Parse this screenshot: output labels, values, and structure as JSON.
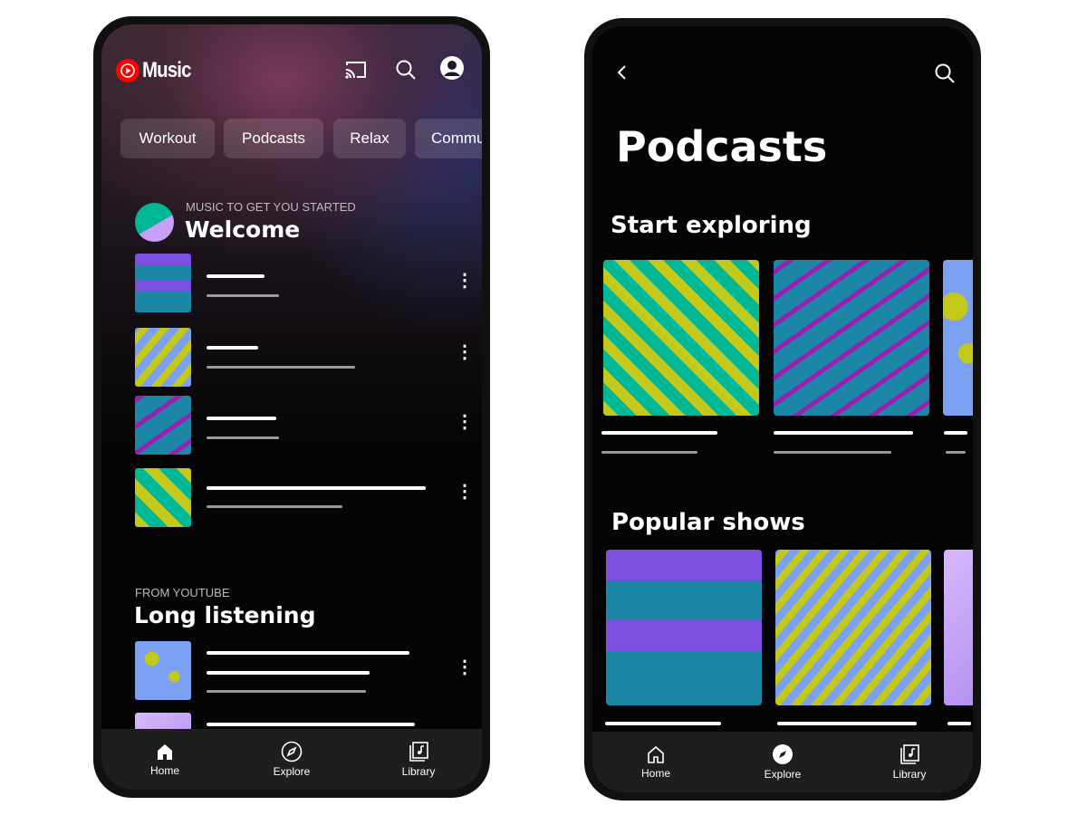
{
  "home": {
    "app_name": "Music",
    "chips": [
      "Workout",
      "Podcasts",
      "Relax",
      "Commu"
    ],
    "section1": {
      "kicker": "MUSIC TO GET YOU STARTED",
      "title": "Welcome"
    },
    "section2": {
      "kicker": "FROM YOUTUBE",
      "title": "Long listening"
    },
    "nav": [
      {
        "label": "Home",
        "icon": "home-filled-icon",
        "active": true
      },
      {
        "label": "Explore",
        "icon": "compass-outline-icon"
      },
      {
        "label": "Library",
        "icon": "library-icon"
      }
    ]
  },
  "podcasts": {
    "title": "Podcasts",
    "section1": "Start exploring",
    "section2": "Popular shows",
    "nav": [
      {
        "label": "Home",
        "icon": "home-outline-icon"
      },
      {
        "label": "Explore",
        "icon": "compass-filled-icon",
        "active": true
      },
      {
        "label": "Library",
        "icon": "library-icon"
      }
    ]
  },
  "colors": {
    "brand_red": "#ff0000",
    "yellow": "#c3c91b",
    "teal": "#00b896",
    "blue": "#1b86a6",
    "magenta": "#9b1fb0",
    "periwinkle": "#7ca0f2",
    "violet": "#7d4fe0"
  }
}
